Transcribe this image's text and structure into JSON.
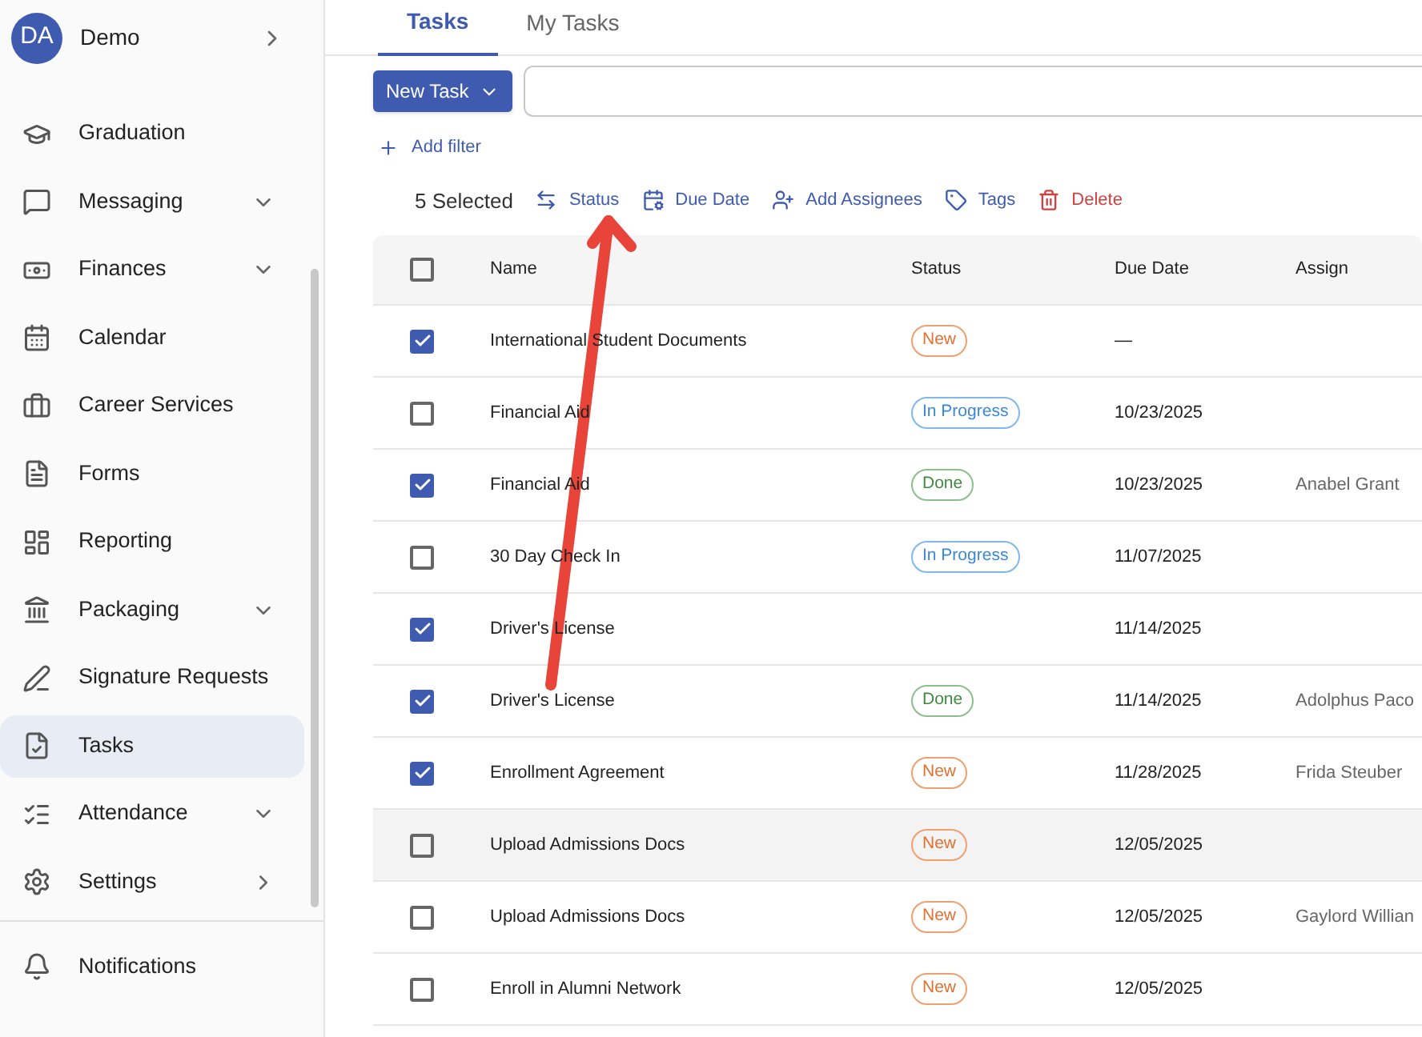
{
  "account": {
    "initials": "DA",
    "name": "Demo"
  },
  "sidebar": {
    "items": [
      {
        "label": "Graduation",
        "kind": "plain",
        "selected": false
      },
      {
        "label": "Messaging",
        "kind": "expandable",
        "selected": false
      },
      {
        "label": "Finances",
        "kind": "expandable",
        "selected": false
      },
      {
        "label": "Calendar",
        "kind": "plain",
        "selected": false
      },
      {
        "label": "Career Services",
        "kind": "plain",
        "selected": false
      },
      {
        "label": "Forms",
        "kind": "plain",
        "selected": false
      },
      {
        "label": "Reporting",
        "kind": "plain",
        "selected": false
      },
      {
        "label": "Packaging",
        "kind": "expandable",
        "selected": false
      },
      {
        "label": "Signature Requests",
        "kind": "plain",
        "selected": false
      },
      {
        "label": "Tasks",
        "kind": "plain",
        "selected": true
      },
      {
        "label": "Attendance",
        "kind": "expandable",
        "selected": false
      },
      {
        "label": "Settings",
        "kind": "submenu",
        "selected": false
      }
    ],
    "footer_items": [
      {
        "label": "Notifications"
      }
    ]
  },
  "tabs": [
    {
      "label": "Tasks",
      "selected": true
    },
    {
      "label": "My Tasks",
      "selected": false
    }
  ],
  "new_task_button": "New Task",
  "add_filter": "Add filter",
  "selection_bar": {
    "count": "5 Selected",
    "actions": [
      {
        "label": "Status",
        "kind": "normal"
      },
      {
        "label": "Due Date",
        "kind": "normal"
      },
      {
        "label": "Add Assignees",
        "kind": "normal"
      },
      {
        "label": "Tags",
        "kind": "normal"
      },
      {
        "label": "Delete",
        "kind": "danger"
      }
    ]
  },
  "table": {
    "header_checked": false,
    "columns": [
      "Name",
      "Status",
      "Due Date",
      "Assign"
    ],
    "rows": [
      {
        "checked": true,
        "highlighted": false,
        "name": "International Student Documents",
        "status": {
          "text": "New",
          "kind": "new"
        },
        "due": "—"
      },
      {
        "checked": false,
        "highlighted": false,
        "name": "Financial Aid",
        "status": {
          "text": "In Progress",
          "kind": "in_progress"
        },
        "due": "10/23/2025"
      },
      {
        "checked": true,
        "highlighted": false,
        "name": "Financial Aid",
        "status": {
          "text": "Done",
          "kind": "done"
        },
        "due": "10/23/2025",
        "assignee": "Anabel Grant"
      },
      {
        "checked": false,
        "highlighted": false,
        "name": "30 Day Check In",
        "status": {
          "text": "In Progress",
          "kind": "in_progress"
        },
        "due": "11/07/2025"
      },
      {
        "checked": true,
        "highlighted": false,
        "name": "Driver's License",
        "due": "11/14/2025"
      },
      {
        "checked": true,
        "highlighted": false,
        "name": "Driver's License",
        "status": {
          "text": "Done",
          "kind": "done"
        },
        "due": "11/14/2025",
        "assignee": "Adolphus Paco"
      },
      {
        "checked": true,
        "highlighted": false,
        "name": "Enrollment Agreement",
        "status": {
          "text": "New",
          "kind": "new"
        },
        "due": "11/28/2025",
        "assignee": "Frida Steuber"
      },
      {
        "checked": false,
        "highlighted": true,
        "name": "Upload Admissions Docs",
        "status": {
          "text": "New",
          "kind": "new"
        },
        "due": "12/05/2025"
      },
      {
        "checked": false,
        "highlighted": false,
        "name": "Upload Admissions Docs",
        "status": {
          "text": "New",
          "kind": "new"
        },
        "due": "12/05/2025",
        "assignee": "Gaylord Willian"
      },
      {
        "checked": false,
        "highlighted": false,
        "name": "Enroll in Alumni Network",
        "status": {
          "text": "New",
          "kind": "new"
        },
        "due": "12/05/2025"
      }
    ]
  }
}
